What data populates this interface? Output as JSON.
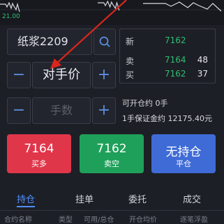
{
  "chart": {
    "y_tick": "21.00",
    "price_line_points": [
      [
        0,
        6
      ],
      [
        8,
        6
      ],
      [
        10,
        10
      ],
      [
        13,
        4
      ],
      [
        16,
        12
      ],
      [
        18,
        5
      ],
      [
        20,
        9
      ],
      [
        23,
        14
      ],
      [
        25,
        6
      ],
      [
        28,
        17
      ]
    ]
  },
  "symbol": {
    "name": "纸浆2209"
  },
  "price_stepper": {
    "minus": "−",
    "value": "对手价",
    "plus": "+"
  },
  "qty_stepper": {
    "minus": "−",
    "placeholder": "手数",
    "plus": "+"
  },
  "quote": {
    "rows": [
      {
        "label": "新",
        "price": "7162",
        "volume": ""
      },
      {
        "label": "卖",
        "price": "7164",
        "volume": "48"
      },
      {
        "label": "买",
        "price": "7162",
        "volume": "37"
      }
    ]
  },
  "account": {
    "openable": "可开仓约 0手",
    "margin": "1手保证金约 12175.40元"
  },
  "actions": {
    "buy": {
      "price": "7164",
      "label": "买多",
      "color": "#e0364a"
    },
    "sell": {
      "price": "7162",
      "label": "卖空",
      "color": "#1fa05a"
    },
    "close": {
      "title": "无持仓",
      "label": "平仓",
      "color": "#3f6bd6"
    }
  },
  "tabs": [
    "持仓",
    "挂单",
    "委托",
    "成交"
  ],
  "active_tab": "持仓",
  "table_header": [
    "合约名称",
    "类型",
    "可用/总仓",
    "开仓均价",
    "逐笔浮盈"
  ],
  "colors": {
    "accent": "#4f8fff",
    "up": "#e0364a",
    "down": "#1fa05a",
    "annotation": "#d9261c"
  }
}
